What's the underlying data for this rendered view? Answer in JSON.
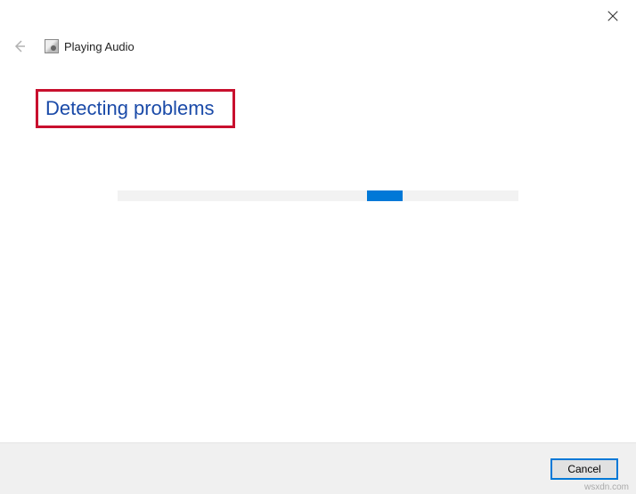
{
  "window": {
    "title": "Playing Audio"
  },
  "content": {
    "heading": "Detecting problems"
  },
  "footer": {
    "cancel_label": "Cancel"
  },
  "watermark": "wsxdn.com",
  "colors": {
    "highlight_border": "#c8102e",
    "link_blue": "#1a4aa8",
    "accent": "#0078d7"
  }
}
